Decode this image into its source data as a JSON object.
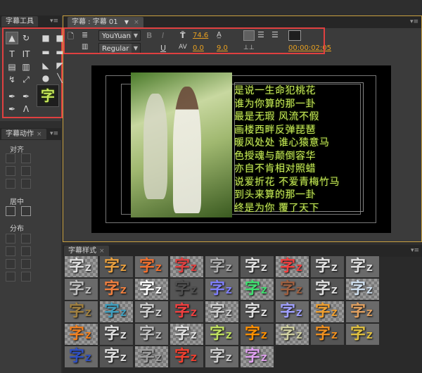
{
  "tools_panel": {
    "title": "字幕工具",
    "tools": [
      {
        "name": "selection-tool-icon",
        "glyph": "▲"
      },
      {
        "name": "rotate-tool-icon",
        "glyph": "↻"
      },
      {
        "name": "type-tool-icon",
        "glyph": "T"
      },
      {
        "name": "vertical-type-tool-icon",
        "glyph": "IT"
      },
      {
        "name": "area-type-tool-icon",
        "glyph": "▤"
      },
      {
        "name": "vertical-area-type-tool-icon",
        "glyph": "▥"
      },
      {
        "name": "path-type-tool-icon",
        "glyph": "↯"
      },
      {
        "name": "vertical-path-type-tool-icon",
        "glyph": "⤢"
      },
      {
        "name": "pen-tool-icon",
        "glyph": "✒"
      },
      {
        "name": "add-anchor-tool-icon",
        "glyph": "✒"
      },
      {
        "name": "delete-anchor-tool-icon",
        "glyph": "✒"
      },
      {
        "name": "convert-anchor-tool-icon",
        "glyph": "ᐱ"
      },
      {
        "name": "rectangle-tool-icon",
        "glyph": "■"
      },
      {
        "name": "clipped-rectangle-tool-icon",
        "glyph": "■"
      },
      {
        "name": "rounded-rectangle-tool-icon",
        "glyph": "▬"
      },
      {
        "name": "rounded-corner-rect-tool-icon",
        "glyph": "▬"
      },
      {
        "name": "wedge-tool-icon",
        "glyph": "◣"
      },
      {
        "name": "arc-tool-icon",
        "glyph": "◤"
      },
      {
        "name": "ellipse-tool-icon",
        "glyph": "●"
      },
      {
        "name": "line-tool-icon",
        "glyph": "╲"
      }
    ],
    "preview_glyph": "字"
  },
  "actions_panel": {
    "title": "字幕动作",
    "align_label": "对齐",
    "center_label": "居中",
    "distribute_label": "分布"
  },
  "editor": {
    "tab_label": "字幕 : 字幕 01",
    "font_family": "YouYuan",
    "font_style": "Regular",
    "font_size": "74.6",
    "kerning": "0.0",
    "leading": "9.0",
    "timecode": "00:00:02:05",
    "poem_lines": [
      "是说一生命犯桃花",
      "谁为你算的那一卦",
      "最是无瑕 风流不假",
      "画楼西畔反弹琵琶",
      "暖风处处 谁心猿意马",
      "色授魂与颠倒容华",
      "亦自不肯相对照蜡",
      "说爱折花 不爱青梅竹马",
      "到头来算的那一卦",
      "终是为你 覆了天下"
    ]
  },
  "styles_panel": {
    "title": "字幕样式",
    "glyph": "字",
    "small_glyph": "Z",
    "swatches": [
      [
        "#e0e0e0",
        "#e8a040",
        "#f07030",
        "#e04040",
        "#b0b0b0",
        "#e0e0e0",
        "#f04040",
        "#e0e0e0",
        "#e0e0e0"
      ],
      [
        "#c0c0c0",
        "#f08040",
        "#ffffff",
        "#505050",
        "#8080ff",
        "#40e070",
        "#a06040",
        "#e0e0e0",
        "#d0e0f0"
      ],
      [
        "#a08040",
        "#40a0c0",
        "#d0d0d0",
        "#f04040",
        "#d0d0d0",
        "#e0e0e0",
        "#a0a0ff",
        "#f0a030",
        "#e0a060"
      ],
      [
        "#f08020",
        "#e0e0e0",
        "#c0c0c0",
        "#e0e0e0",
        "#c0e060",
        "#ff9000",
        "#d0d0a0",
        "#f09020",
        "#e0c040"
      ],
      [
        "#3050c0",
        "#e0e0e0",
        "#a0a0a0",
        "#f04030",
        "#d0d0d0",
        "#e0a0f0"
      ]
    ]
  }
}
